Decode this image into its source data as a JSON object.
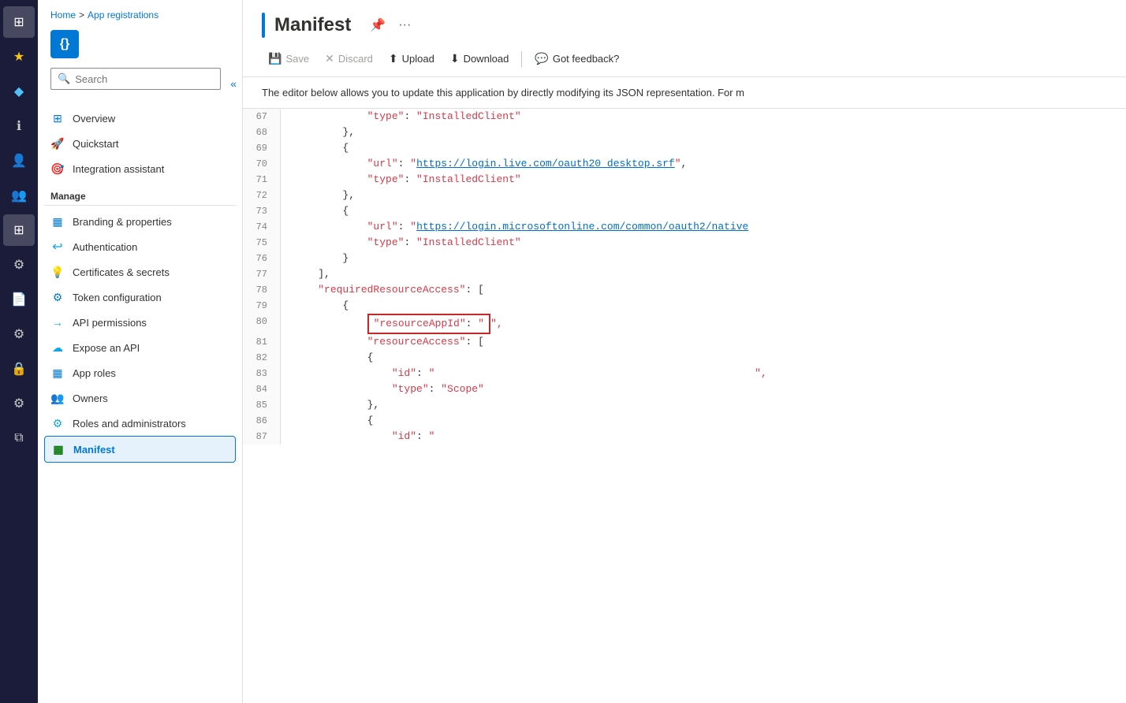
{
  "iconBar": {
    "items": [
      {
        "name": "home-icon",
        "icon": "⊞",
        "active": false
      },
      {
        "name": "favorites-icon",
        "icon": "★",
        "active": false
      },
      {
        "name": "recent-icon",
        "icon": "◆",
        "active": false,
        "highlight": true
      },
      {
        "name": "info-icon",
        "icon": "ℹ",
        "active": false
      },
      {
        "name": "user-icon",
        "icon": "👤",
        "active": false
      },
      {
        "name": "group-icon",
        "icon": "👥",
        "active": false
      },
      {
        "name": "grid-icon",
        "icon": "⊞",
        "active": true
      },
      {
        "name": "roles-icon",
        "icon": "⚙",
        "active": false
      },
      {
        "name": "doc-icon",
        "icon": "📄",
        "active": false
      },
      {
        "name": "settings-icon",
        "icon": "⚙",
        "active": false
      },
      {
        "name": "lock-icon",
        "icon": "🔒",
        "active": false
      },
      {
        "name": "cog-icon",
        "icon": "⚙",
        "active": false
      },
      {
        "name": "copy-icon",
        "icon": "⧉",
        "active": false
      }
    ]
  },
  "breadcrumb": {
    "home": "Home",
    "separator": ">",
    "current": "App registrations"
  },
  "appIcon": {
    "symbol": "{}"
  },
  "search": {
    "placeholder": "Search",
    "collapse_label": "«"
  },
  "navItems": [
    {
      "name": "overview",
      "label": "Overview",
      "icon": "⊞",
      "iconColor": "#0078d4"
    },
    {
      "name": "quickstart",
      "label": "Quickstart",
      "icon": "🚀",
      "iconColor": "#0ea5e9"
    },
    {
      "name": "integration-assistant",
      "label": "Integration assistant",
      "icon": "🎯",
      "iconColor": "#f59e0b"
    }
  ],
  "manageLabel": "Manage",
  "manageItems": [
    {
      "name": "branding",
      "label": "Branding & properties",
      "icon": "▦",
      "iconColor": "#0078d4"
    },
    {
      "name": "authentication",
      "label": "Authentication",
      "icon": "↩",
      "iconColor": "#0ea5e9"
    },
    {
      "name": "certificates",
      "label": "Certificates & secrets",
      "icon": "💡",
      "iconColor": "#f59e0b"
    },
    {
      "name": "token-config",
      "label": "Token configuration",
      "icon": "⚙",
      "iconColor": "#0078d4"
    },
    {
      "name": "api-permissions",
      "label": "API permissions",
      "icon": "→",
      "iconColor": "#0ea5e9"
    },
    {
      "name": "expose-api",
      "label": "Expose an API",
      "icon": "☁",
      "iconColor": "#0ea5e9"
    },
    {
      "name": "app-roles",
      "label": "App roles",
      "icon": "▦",
      "iconColor": "#0078d4"
    },
    {
      "name": "owners",
      "label": "Owners",
      "icon": "👥",
      "iconColor": "#0ea5e9"
    },
    {
      "name": "roles-admin",
      "label": "Roles and administrators",
      "icon": "⚙",
      "iconColor": "#0ea5e9"
    },
    {
      "name": "manifest",
      "label": "Manifest",
      "icon": "▦",
      "iconColor": "#107c10",
      "active": true
    }
  ],
  "pageTitle": "Manifest",
  "toolbar": {
    "save": "Save",
    "discard": "Discard",
    "upload": "Upload",
    "download": "Download",
    "feedback": "Got feedback?"
  },
  "description": "The editor below allows you to update this application by directly modifying its JSON representation. For m",
  "codeLines": [
    {
      "num": "67",
      "content": "            \"type\": \"InstalledClient\"",
      "type": "normal"
    },
    {
      "num": "68",
      "content": "        },",
      "type": "normal"
    },
    {
      "num": "69",
      "content": "        {",
      "type": "normal"
    },
    {
      "num": "70",
      "content": "            \"url\": \"https://login.live.com/oauth20_desktop.srf\",",
      "type": "url",
      "urlPart": "https://login.live.com/oauth20_desktop.srf"
    },
    {
      "num": "71",
      "content": "            \"type\": \"InstalledClient\"",
      "type": "normal"
    },
    {
      "num": "72",
      "content": "        },",
      "type": "normal"
    },
    {
      "num": "73",
      "content": "        {",
      "type": "normal"
    },
    {
      "num": "74",
      "content": "            \"url\": \"https://login.microsoftonline.com/common/oauth2/native",
      "type": "url-truncated",
      "urlPart": "https://login.microsoftonline.com/common/oauth2/native"
    },
    {
      "num": "75",
      "content": "            \"type\": \"InstalledClient\"",
      "type": "normal"
    },
    {
      "num": "76",
      "content": "        }",
      "type": "normal"
    },
    {
      "num": "77",
      "content": "    ],",
      "type": "normal"
    },
    {
      "num": "78",
      "content": "    \"requiredResourceAccess\": [",
      "type": "key"
    },
    {
      "num": "79",
      "content": "        {",
      "type": "normal"
    },
    {
      "num": "80",
      "content": "            \"resourceAppId\": \"",
      "type": "highlight-key"
    },
    {
      "num": "81",
      "content": "            \"resourceAccess\": [",
      "type": "key-indent"
    },
    {
      "num": "82",
      "content": "            {",
      "type": "normal"
    },
    {
      "num": "83",
      "content": "                \"id\": \"",
      "type": "key-deep"
    },
    {
      "num": "84",
      "content": "                \"type\": \"Scope\"",
      "type": "normal"
    },
    {
      "num": "85",
      "content": "            },",
      "type": "normal"
    },
    {
      "num": "86",
      "content": "            {",
      "type": "normal"
    },
    {
      "num": "87",
      "content": "                \"id\": \"",
      "type": "key-deep-end"
    }
  ]
}
